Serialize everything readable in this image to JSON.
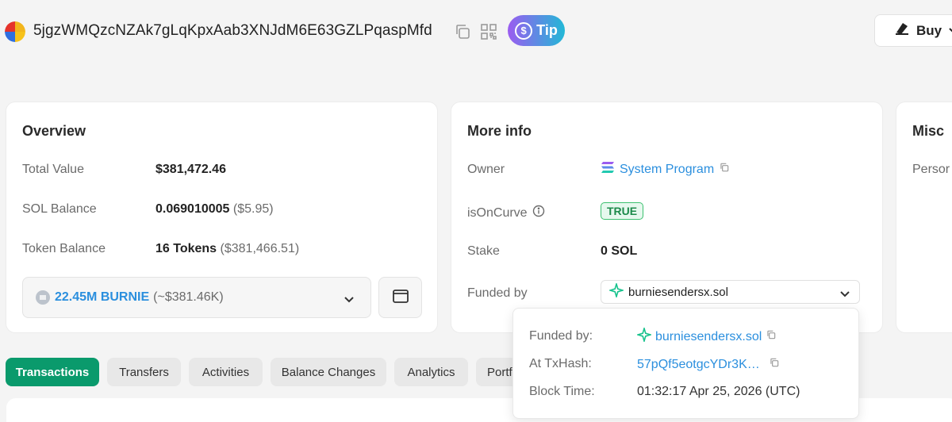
{
  "header": {
    "address": "5jgzWMQzcNZAk7gLqKpxAab3XNJdM6E63GZLPqaspMfd",
    "tip_label": "Tip",
    "buy_label": "Buy"
  },
  "overview": {
    "title": "Overview",
    "total_value_label": "Total Value",
    "total_value": "$381,472.46",
    "sol_balance_label": "SOL Balance",
    "sol_balance": "0.069010005",
    "sol_balance_usd": "($5.95)",
    "token_balance_label": "Token Balance",
    "token_balance": "16 Tokens",
    "token_balance_usd": "($381,466.51)",
    "token_select_amount": "22.45M BURNIE",
    "token_select_usd": "(~$381.46K)"
  },
  "more_info": {
    "title": "More info",
    "owner_label": "Owner",
    "owner_value": "System Program",
    "is_on_curve_label": "isOnCurve",
    "is_on_curve_value": "TRUE",
    "stake_label": "Stake",
    "stake_value": "0 SOL",
    "funded_by_label": "Funded by",
    "funded_by_value": "burniesendersx.sol"
  },
  "misc": {
    "title": "Misc",
    "first_label": "Persor"
  },
  "funded_popover": {
    "funded_by_label": "Funded by:",
    "funded_by_value": "burniesendersx.sol",
    "tx_hash_label": "At TxHash:",
    "tx_hash_value": "57pQf5eotgcYDr3K…",
    "block_time_label": "Block Time:",
    "block_time_value": "01:32:17 Apr 25, 2026 (UTC)"
  },
  "tabs": [
    {
      "label": "Transactions",
      "active": true
    },
    {
      "label": "Transfers",
      "active": false
    },
    {
      "label": "Activities",
      "active": false
    },
    {
      "label": "Balance Changes",
      "active": false
    },
    {
      "label": "Analytics",
      "active": false
    },
    {
      "label": "Portf",
      "active": false
    }
  ],
  "colors": {
    "accent_green": "#0a9a6c",
    "link_blue": "#2b8fde",
    "true_green": "#1c8a4a"
  }
}
